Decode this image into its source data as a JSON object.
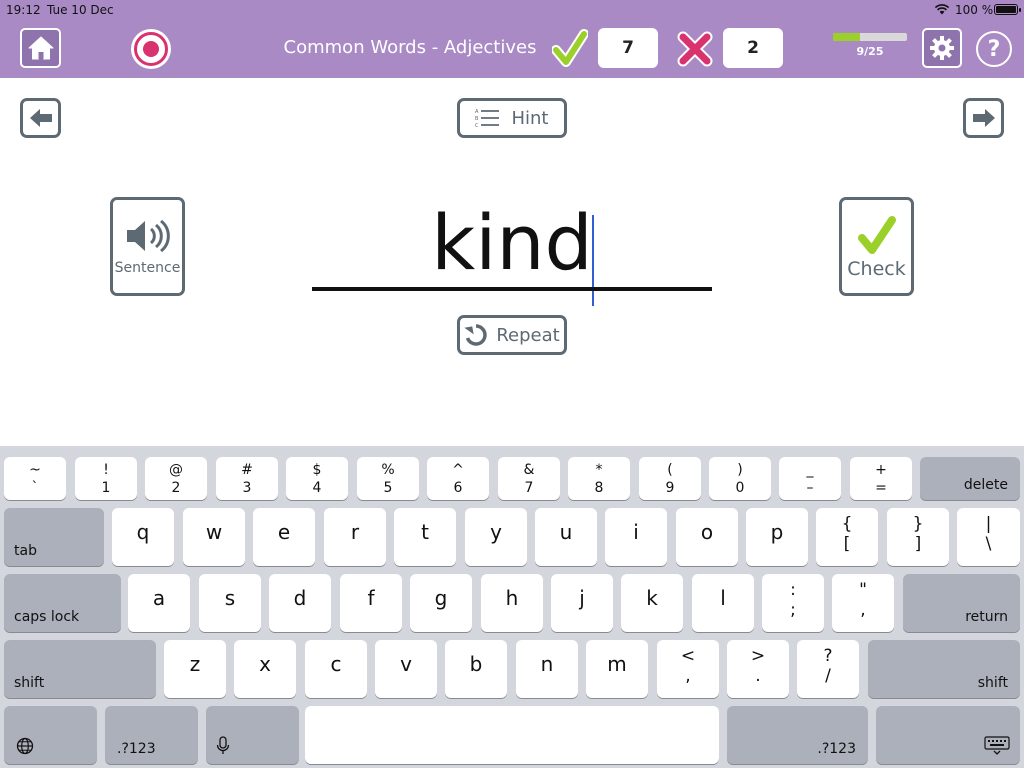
{
  "status_bar": {
    "time": "19:12",
    "date": "Tue 10 Dec",
    "battery": "100 %"
  },
  "header": {
    "title": "Common Words - Adjectives",
    "correct_count": "7",
    "wrong_count": "2",
    "progress_label": "9/25",
    "progress_fraction": 0.36,
    "colors": {
      "bar": "#a98ac5",
      "correct": "#9bd02a",
      "wrong": "#d8326f"
    }
  },
  "main": {
    "hint_label": "Hint",
    "sentence_label": "Sentence",
    "check_label": "Check",
    "repeat_label": "Repeat",
    "word": "kind"
  },
  "keyboard": {
    "row1": [
      {
        "top": "~",
        "bot": "`"
      },
      {
        "top": "!",
        "bot": "1"
      },
      {
        "top": "@",
        "bot": "2"
      },
      {
        "top": "#",
        "bot": "3"
      },
      {
        "top": "$",
        "bot": "4"
      },
      {
        "top": "%",
        "bot": "5"
      },
      {
        "top": "^",
        "bot": "6"
      },
      {
        "top": "&",
        "bot": "7"
      },
      {
        "top": "*",
        "bot": "8"
      },
      {
        "top": "(",
        "bot": "9"
      },
      {
        "top": ")",
        "bot": "0"
      },
      {
        "top": "_",
        "bot": "–"
      },
      {
        "top": "+",
        "bot": "="
      }
    ],
    "delete_label": "delete",
    "tab_label": "tab",
    "row2": [
      "q",
      "w",
      "e",
      "r",
      "t",
      "y",
      "u",
      "i",
      "o",
      "p"
    ],
    "row2_sym": [
      {
        "top": "{",
        "bot": "["
      },
      {
        "top": "}",
        "bot": "]"
      },
      {
        "top": "|",
        "bot": "\\"
      }
    ],
    "caps_label": "caps lock",
    "row3": [
      "a",
      "s",
      "d",
      "f",
      "g",
      "h",
      "j",
      "k",
      "l"
    ],
    "row3_sym": [
      {
        "top": ":",
        "bot": ";"
      },
      {
        "top": "\"",
        "bot": ","
      }
    ],
    "return_label": "return",
    "shift_label": "shift",
    "row4": [
      "z",
      "x",
      "c",
      "v",
      "b",
      "n",
      "m"
    ],
    "row4_sym": [
      {
        "top": "<",
        "bot": ","
      },
      {
        "top": ">",
        "bot": "."
      },
      {
        "top": "?",
        "bot": "/"
      }
    ],
    "numbers_label": ".?123"
  }
}
